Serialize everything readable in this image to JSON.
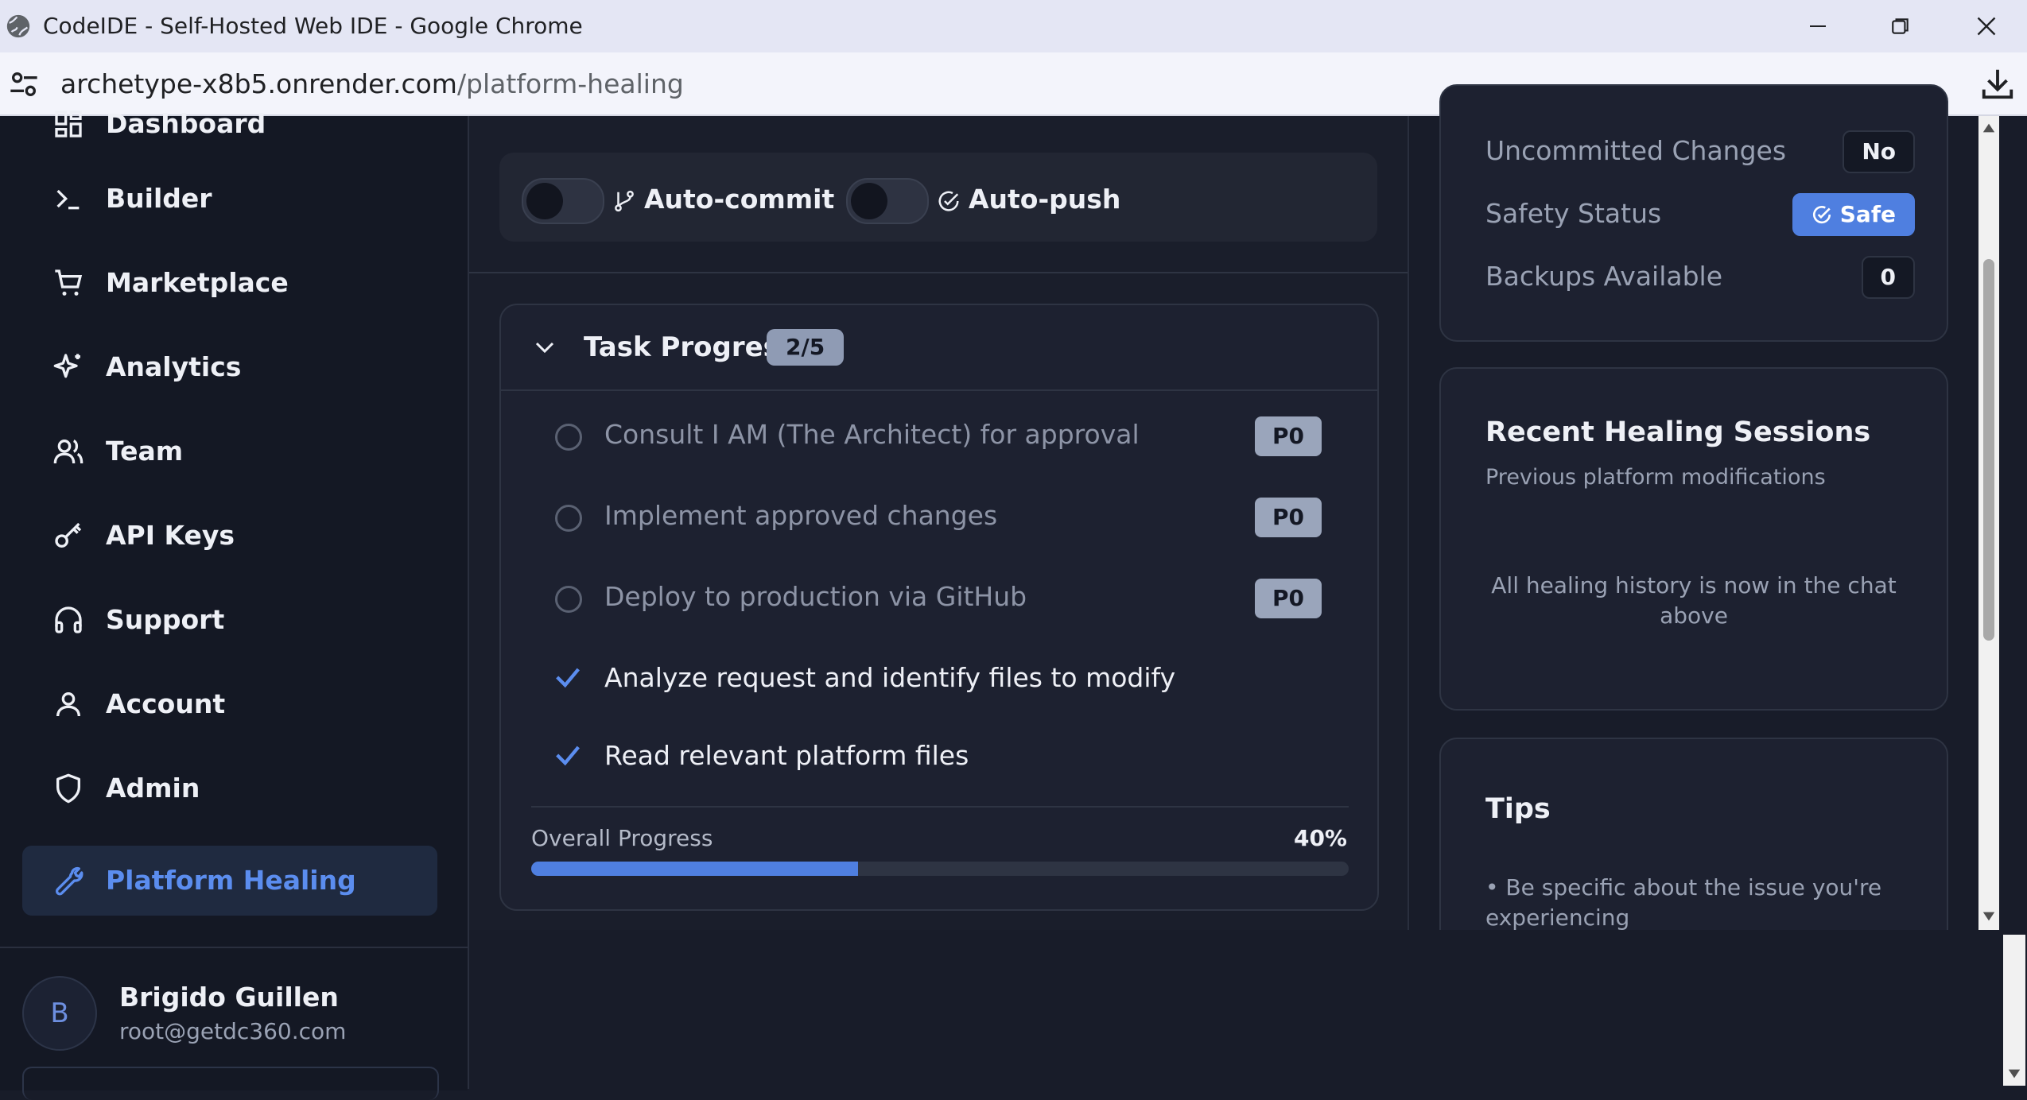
{
  "browser": {
    "window_title": "CodeIDE - Self-Hosted Web IDE - Google Chrome",
    "url_host": "archetype-x8b5.onrender.com",
    "url_path": "/platform-healing"
  },
  "sidebar": {
    "items": [
      {
        "label": "Dashboard",
        "icon": "dashboard-icon"
      },
      {
        "label": "Builder",
        "icon": "terminal-icon"
      },
      {
        "label": "Marketplace",
        "icon": "cart-icon"
      },
      {
        "label": "Analytics",
        "icon": "sparkles-icon"
      },
      {
        "label": "Team",
        "icon": "users-icon"
      },
      {
        "label": "API Keys",
        "icon": "key-icon"
      },
      {
        "label": "Support",
        "icon": "headphones-icon"
      },
      {
        "label": "Account",
        "icon": "user-icon"
      },
      {
        "label": "Admin",
        "icon": "shield-icon"
      },
      {
        "label": "Platform Healing",
        "icon": "wrench-icon"
      }
    ],
    "active": "Platform Healing"
  },
  "user": {
    "initial": "B",
    "name": "Brigido Guillen",
    "email": "root@getdc360.com"
  },
  "toggles": {
    "auto_commit": {
      "label": "Auto-commit",
      "on": false
    },
    "auto_push": {
      "label": "Auto-push",
      "on": false
    }
  },
  "tasks": {
    "title": "Task Progress",
    "count": "2/5",
    "items": [
      {
        "text": "Consult I AM (The Architect) for approval",
        "done": false,
        "priority": "P0"
      },
      {
        "text": "Implement approved changes",
        "done": false,
        "priority": "P0"
      },
      {
        "text": "Deploy to production via GitHub",
        "done": false,
        "priority": "P0"
      },
      {
        "text": "Analyze request and identify files to modify",
        "done": true
      },
      {
        "text": "Read relevant platform files",
        "done": true
      }
    ],
    "overall_label": "Overall Progress",
    "overall_value": "40%",
    "progress_fraction": 0.4
  },
  "status": {
    "rows": [
      {
        "label": "Uncommitted Changes",
        "value": "No"
      },
      {
        "label": "Safety Status",
        "value": "Safe"
      },
      {
        "label": "Backups Available",
        "value": "0"
      }
    ]
  },
  "recent": {
    "title": "Recent Healing Sessions",
    "subtitle": "Previous platform modifications",
    "empty": "All healing history is now in the chat above"
  },
  "tips": {
    "title": "Tips",
    "items": [
      "• Be specific about the issue you're experiencing"
    ]
  },
  "colors": {
    "accent": "#4f7fe0",
    "sidebar_bg": "#141824",
    "panel_bg": "#1d2130"
  }
}
